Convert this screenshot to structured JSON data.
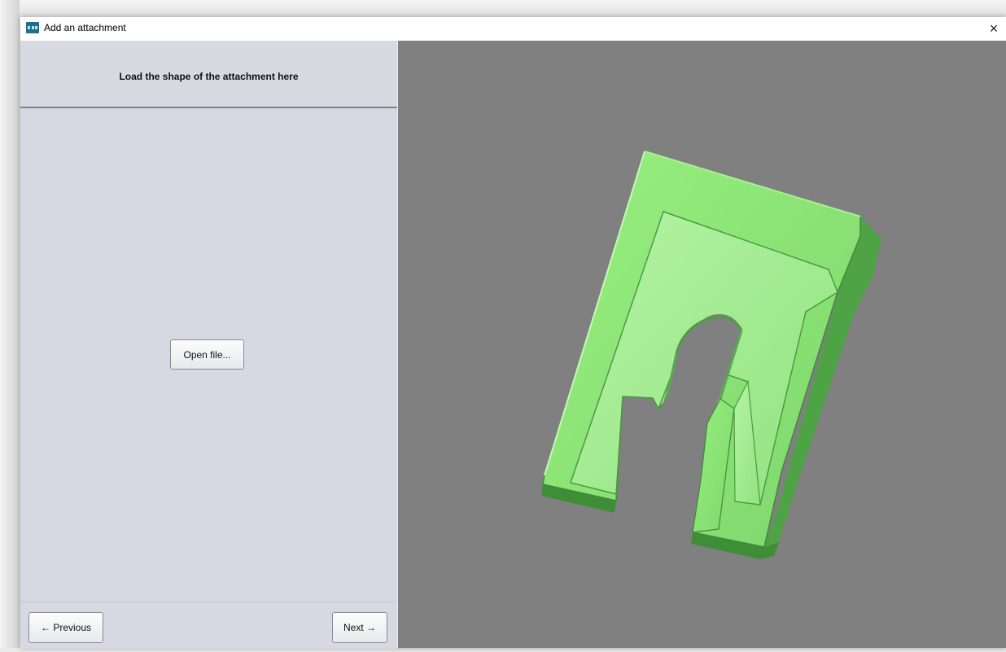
{
  "window": {
    "title": "Add an attachment",
    "close_glyph": "×"
  },
  "wizard": {
    "heading": "Load the shape of the attachment here",
    "open_file_label": "Open file...",
    "previous_label": "← Previous",
    "next_label": "Next →"
  },
  "viewport": {
    "background_color": "#808080",
    "model_color": "#8fe87a"
  },
  "icons": {
    "app": "app-icon",
    "close": "close-icon"
  }
}
